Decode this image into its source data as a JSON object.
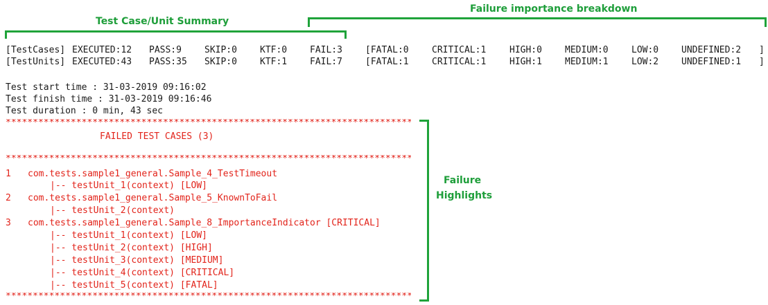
{
  "annotations": {
    "summary": "Test Case/Unit Summary",
    "breakdown": "Failure importance breakdown",
    "highlights_line1": "Failure",
    "highlights_line2": "Highlights"
  },
  "summary_rows": [
    {
      "label": "[TestCases]",
      "executed": "EXECUTED:12",
      "pass": "PASS:9",
      "skip": "SKIP:0",
      "ktf": "KTF:0",
      "fail": "FAIL:3",
      "fatal": "[FATAL:0",
      "critical": "CRITICAL:1",
      "high": "HIGH:0",
      "medium": "MEDIUM:0",
      "low": "LOW:0",
      "undefined": "UNDEFINED:2",
      "close": "]"
    },
    {
      "label": "[TestUnits]",
      "executed": "EXECUTED:43",
      "pass": "PASS:35",
      "skip": "SKIP:0",
      "ktf": "KTF:1",
      "fail": "FAIL:7",
      "fatal": "[FATAL:1",
      "critical": "CRITICAL:1",
      "high": "HIGH:1",
      "medium": "MEDIUM:1",
      "low": "LOW:2",
      "undefined": "UNDEFINED:1",
      "close": "]"
    }
  ],
  "times": {
    "start": "Test start time : 31-03-2019 09:16:02",
    "finish": "Test finish time : 31-03-2019 09:16:46",
    "duration": "Test duration : 0 min, 43 sec"
  },
  "failed": {
    "stars": "**********************************************************************************",
    "header": "FAILED TEST CASES (3)",
    "cases": [
      {
        "num": "1",
        "name": "com.tests.sample1_general.Sample_4_TestTimeout",
        "units": [
          "|-- testUnit_1(context) [LOW]"
        ]
      },
      {
        "num": "2",
        "name": "com.tests.sample1_general.Sample_5_KnownToFail",
        "units": [
          "|-- testUnit_2(context)"
        ]
      },
      {
        "num": "3",
        "name": "com.tests.sample1_general.Sample_8_ImportanceIndicator [CRITICAL]",
        "units": [
          "|-- testUnit_1(context) [LOW]",
          "|-- testUnit_2(context) [HIGH]",
          "|-- testUnit_3(context) [MEDIUM]",
          "|-- testUnit_4(context) [CRITICAL]",
          "|-- testUnit_5(context) [FATAL]"
        ]
      }
    ]
  }
}
